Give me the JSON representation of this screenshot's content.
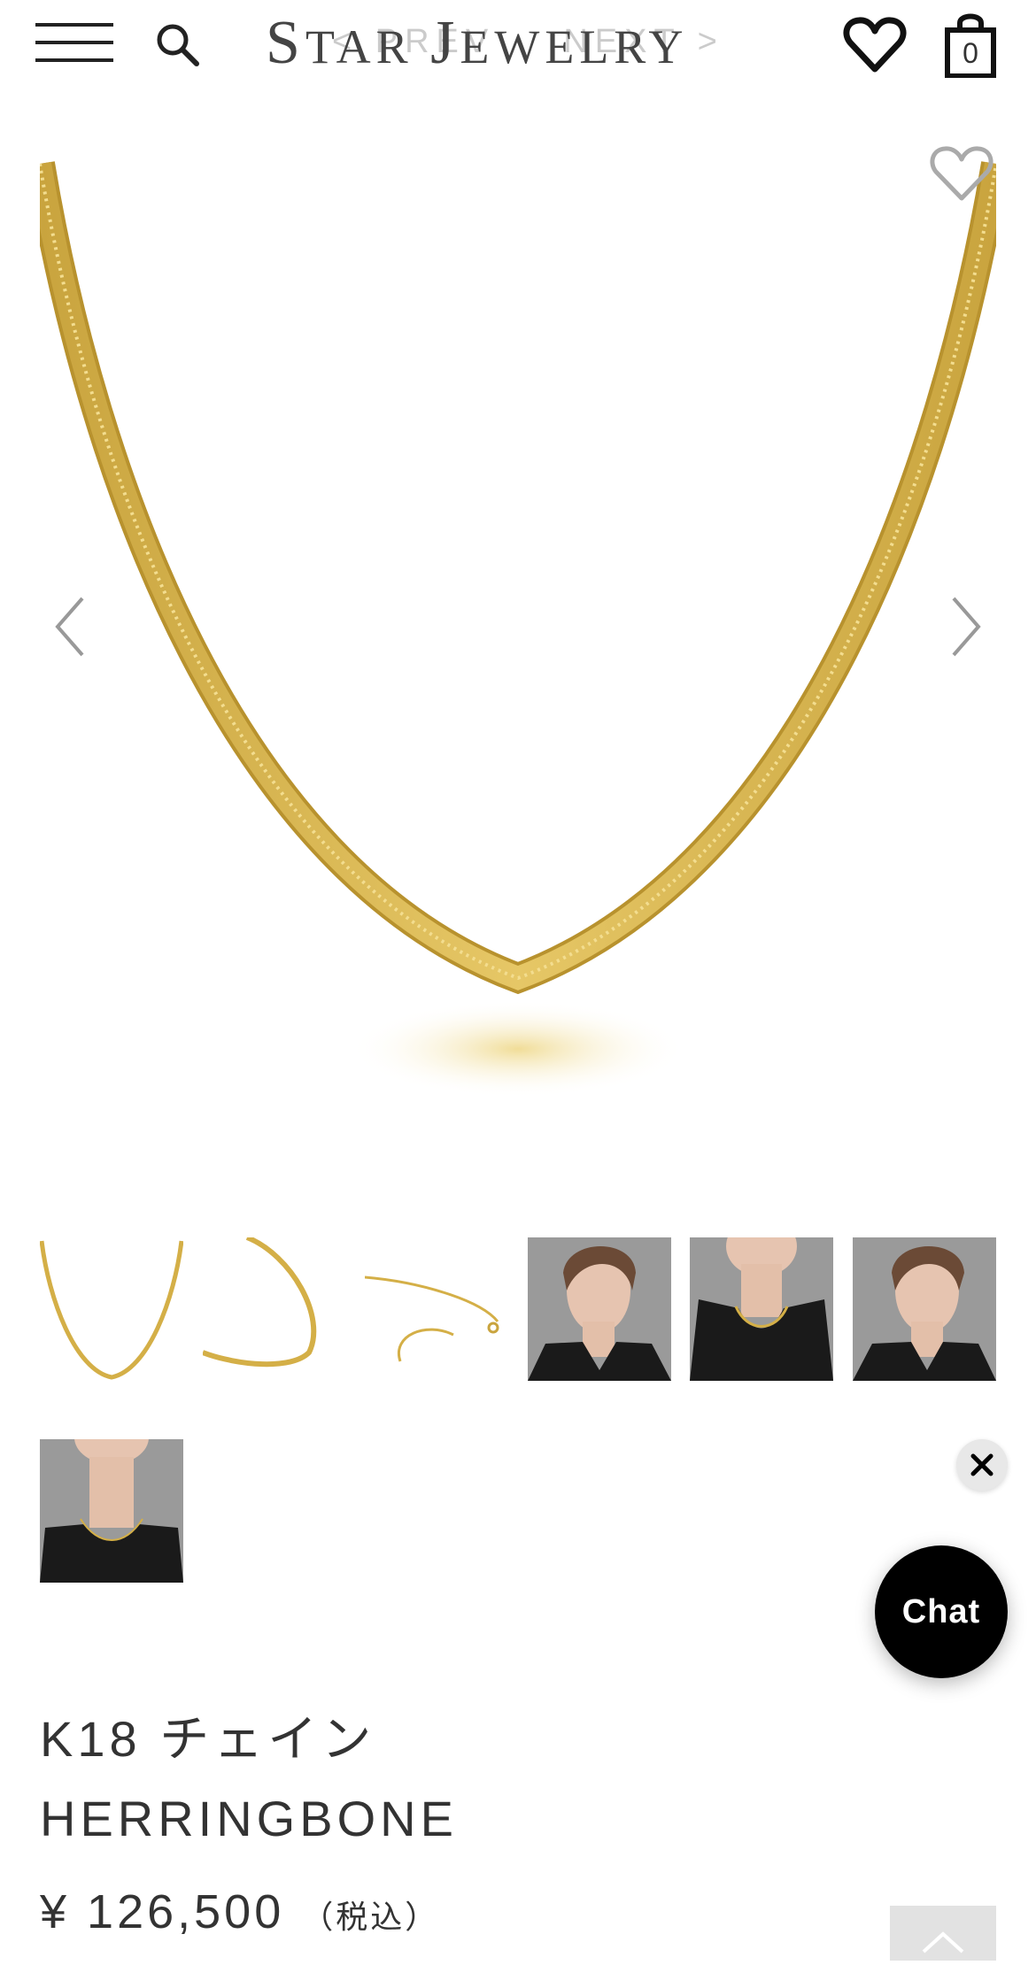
{
  "header": {
    "logo_first": "S",
    "logo_rest1": "TAR ",
    "logo_j": "J",
    "logo_rest2": "EWELRY",
    "prev_label": "< PREV",
    "next_label": "NEXT >",
    "cart_count": "0",
    "icons": [
      "menu-icon",
      "search-icon",
      "heart-icon",
      "shopping-bag-icon"
    ]
  },
  "gallery": {
    "thumbnails": [
      {
        "kind": "necklace-front"
      },
      {
        "kind": "necklace-side"
      },
      {
        "kind": "necklace-clasp"
      },
      {
        "kind": "model-left"
      },
      {
        "kind": "model-front"
      },
      {
        "kind": "model-right"
      },
      {
        "kind": "model-closeup"
      }
    ]
  },
  "chat": {
    "label": "Chat"
  },
  "product": {
    "name_line1": "K18 チェイン",
    "name_line2": "HERRINGBONE",
    "price": "¥ 126,500",
    "tax_label": "（税込）"
  },
  "colors": {
    "gold": "#d9b44a",
    "text": "#333333",
    "chat_bg": "#000000"
  }
}
